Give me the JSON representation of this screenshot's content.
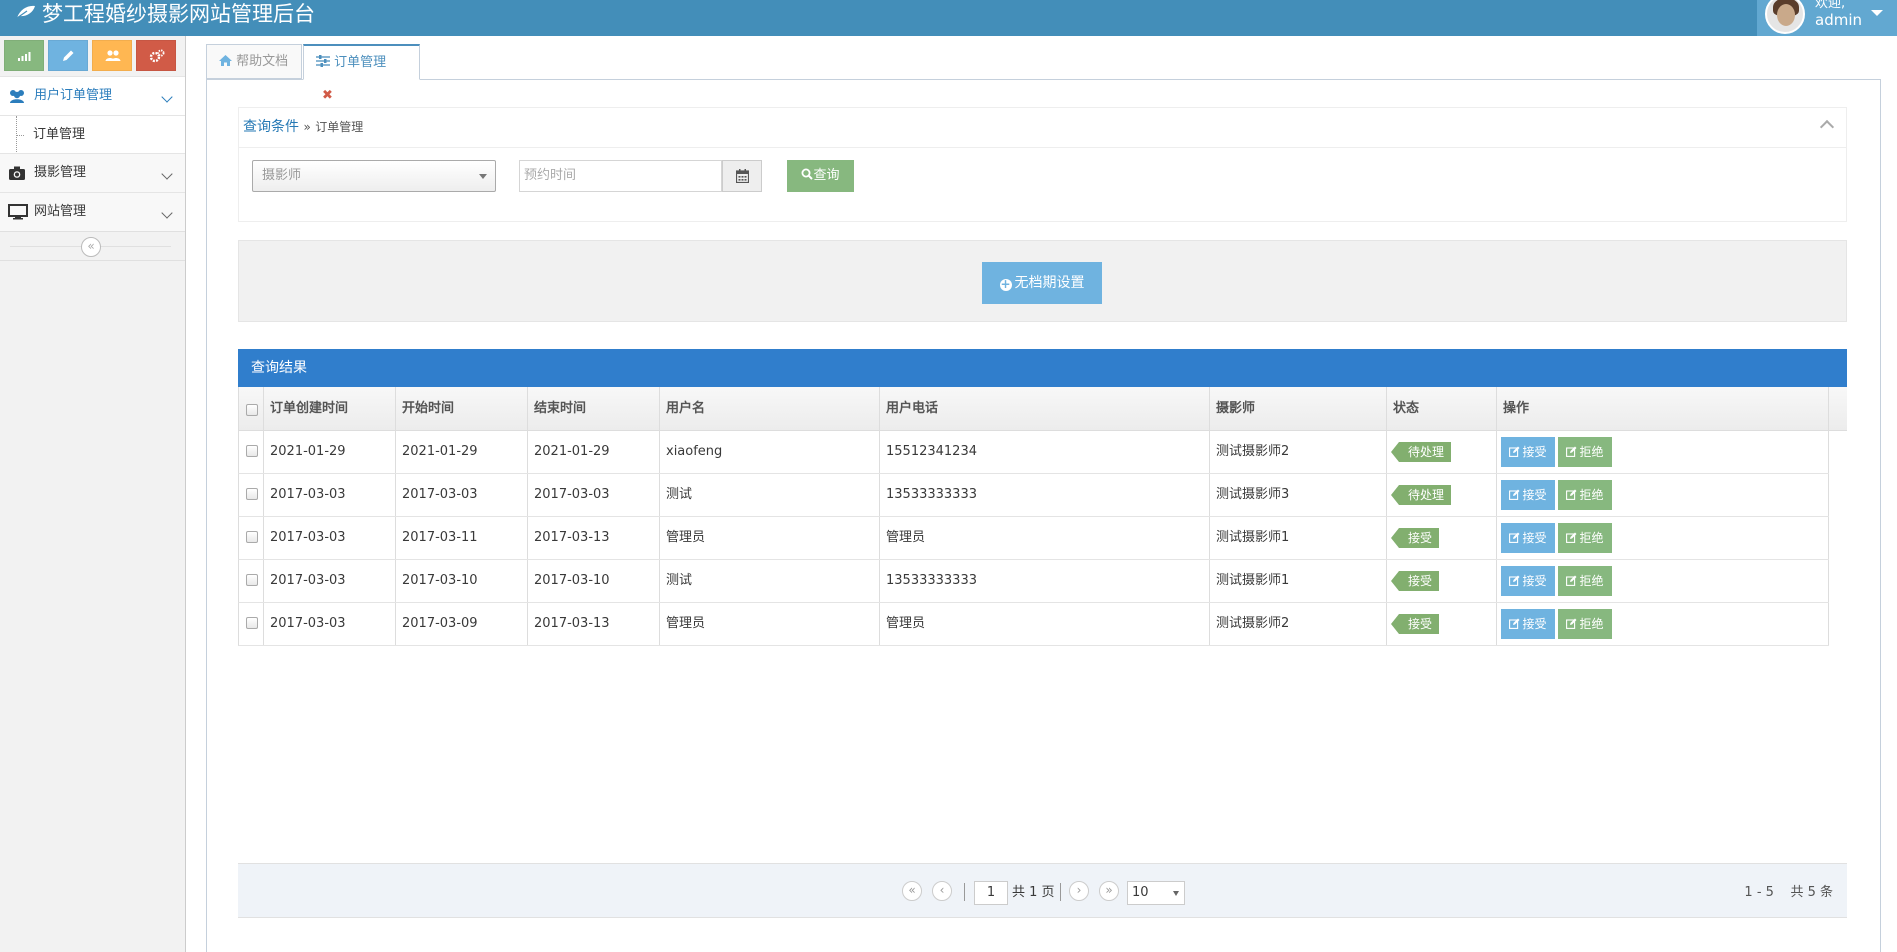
{
  "app": {
    "title": "梦工程婚纱摄影网站管理后台"
  },
  "user": {
    "welcome": "欢迎,",
    "name": "admin"
  },
  "colors": {
    "navbar": "#438eb9",
    "primary": "#307ecc",
    "success": "#87b87f",
    "info": "#6fb3e0",
    "danger": "#d15b47",
    "warning": "#ffb752"
  },
  "shortcuts": [
    {
      "icon": "signal-icon",
      "color": "#87b87f"
    },
    {
      "icon": "pencil-icon",
      "color": "#6fb3e0"
    },
    {
      "icon": "users-icon",
      "color": "#ffb752"
    },
    {
      "icon": "cogs-icon",
      "color": "#d15b47"
    }
  ],
  "sidebar": {
    "groups": [
      {
        "label": "用户订单管理",
        "icon": "users-icon",
        "children": [
          {
            "label": "订单管理"
          }
        ]
      },
      {
        "label": "摄影管理",
        "icon": "camera-icon"
      },
      {
        "label": "网站管理",
        "icon": "desktop-icon"
      }
    ]
  },
  "tabs": [
    {
      "label": "帮助文档",
      "icon": "home-icon"
    },
    {
      "label": "订单管理",
      "icon": "sliders-icon",
      "close_glyph": "✖"
    }
  ],
  "query": {
    "crumb_main": "查询条件",
    "crumb_sep": "»",
    "crumb_sub": "订单管理",
    "photographer_placeholder": "摄影师",
    "date_placeholder": "预约时间",
    "search_label": "查询"
  },
  "band": {
    "button_label": "无档期设置"
  },
  "grid": {
    "caption": "查询结果",
    "columns": [
      "订单创建时间",
      "开始时间",
      "结束时间",
      "用户名",
      "用户电话",
      "摄影师",
      "状态",
      "操作"
    ],
    "accept_label": "接受",
    "reject_label": "拒绝",
    "rows": [
      [
        "2021-01-29",
        "2021-01-29",
        "2021-01-29",
        "xiaofeng",
        "15512341234",
        "测试摄影师2",
        "待处理"
      ],
      [
        "2017-03-03",
        "2017-03-03",
        "2017-03-03",
        "测试",
        "13533333333",
        "测试摄影师3",
        "待处理"
      ],
      [
        "2017-03-03",
        "2017-03-11",
        "2017-03-13",
        "管理员",
        "管理员",
        "测试摄影师1",
        "接受"
      ],
      [
        "2017-03-03",
        "2017-03-10",
        "2017-03-10",
        "测试",
        "13533333333",
        "测试摄影师1",
        "接受"
      ],
      [
        "2017-03-03",
        "2017-03-09",
        "2017-03-13",
        "管理员",
        "管理员",
        "测试摄影师2",
        "接受"
      ]
    ]
  },
  "pager": {
    "current_page": "1",
    "total_pages_text": "共 1 页",
    "page_size": "10",
    "range_text": "1 - 5",
    "total_text": "共 5 条"
  }
}
